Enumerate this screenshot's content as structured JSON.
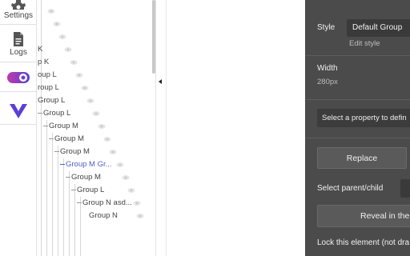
{
  "rail": {
    "settings_label": "Settings",
    "logs_label": "Logs",
    "icons": [
      "gear-icon",
      "document-icon",
      "toggle-icon",
      "plugin-icon"
    ],
    "colors": {
      "toggle_start": "#c039a8",
      "toggle_end": "#5a3fd8",
      "plugin": "#5b3fd6"
    }
  },
  "tree": {
    "items": [
      {
        "label": "K"
      },
      {
        "label": "p K"
      },
      {
        "label": "oup L"
      },
      {
        "label": "roup L"
      },
      {
        "label": "Group L"
      },
      {
        "label": "Group L"
      },
      {
        "label": "Group M"
      },
      {
        "label": "Group M"
      },
      {
        "label": "Group M"
      },
      {
        "label": "Group M Gr...",
        "selected": true
      },
      {
        "label": "Group M"
      },
      {
        "label": "Group L"
      },
      {
        "label": "Group N asd..."
      },
      {
        "label": "Group N"
      }
    ],
    "selected_color": "#4a5cc6"
  },
  "editor": {
    "style_label": "Style",
    "style_value": "Default Group",
    "edit_style_link": "Edit style",
    "width_label": "Width",
    "width_value": "280px",
    "property_select_placeholder": "Select a property to defin",
    "replace_button": "Replace",
    "select_parent_label": "Select parent/child",
    "reveal_button": "Reveal in the",
    "lock_label": "Lock this element (not dra",
    "background_color": "#4b4b4b"
  }
}
